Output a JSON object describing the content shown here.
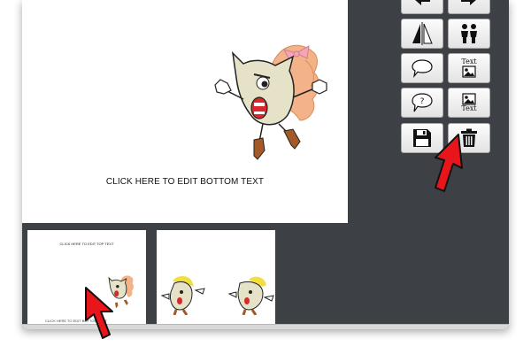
{
  "canvas": {
    "bottom_text": "CLICK HERE TO EDIT BOTTOM TEXT"
  },
  "thumbnails": [
    {
      "top_text": "CLICK HERE TO EDIT TOP TEXT",
      "bottom_text": "CLICK HERE TO EDIT BOTTOM TEXT"
    },
    {}
  ],
  "toolbar": {
    "buttons": [
      {
        "icon": "arrow-left-icon"
      },
      {
        "icon": "arrow-right-icon"
      },
      {
        "icon": "flip-horizontal-icon"
      },
      {
        "icon": "two-people-icon"
      },
      {
        "icon": "speech-bubble-icon"
      },
      {
        "icon": "text-image-icon",
        "label": "Text"
      },
      {
        "icon": "question-bubble-icon"
      },
      {
        "icon": "image-text-icon",
        "label": "Text"
      },
      {
        "icon": "save-icon"
      },
      {
        "icon": "trash-icon"
      }
    ]
  },
  "colors": {
    "window_background": "#3d4045",
    "cursor": "#e8151b"
  }
}
